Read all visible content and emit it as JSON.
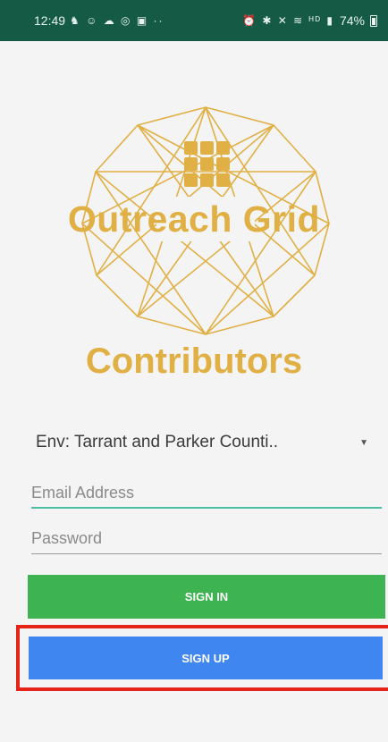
{
  "status_bar": {
    "time": "12:49",
    "notification_icons": "♞ ☺ ☁ ◎ ▣ ··",
    "system_icons": "⏰ ✱ ✕ ≋ ᴴᴰ ▮",
    "battery": "74%"
  },
  "brand": {
    "name": "Outreach Grid",
    "subtitle": "Contributors",
    "accent_color": "#e0b045"
  },
  "env_select": {
    "value": "Env: Tarrant and Parker Counti.."
  },
  "form": {
    "email_placeholder": "Email Address",
    "password_placeholder": "Password"
  },
  "buttons": {
    "sign_in": "SIGN IN",
    "sign_up": "SIGN UP",
    "sign_in_color": "#3db352",
    "sign_up_color": "#3f86f0"
  },
  "icons": [
    "logo-icon",
    "caret-down-icon",
    "battery-icon"
  ]
}
